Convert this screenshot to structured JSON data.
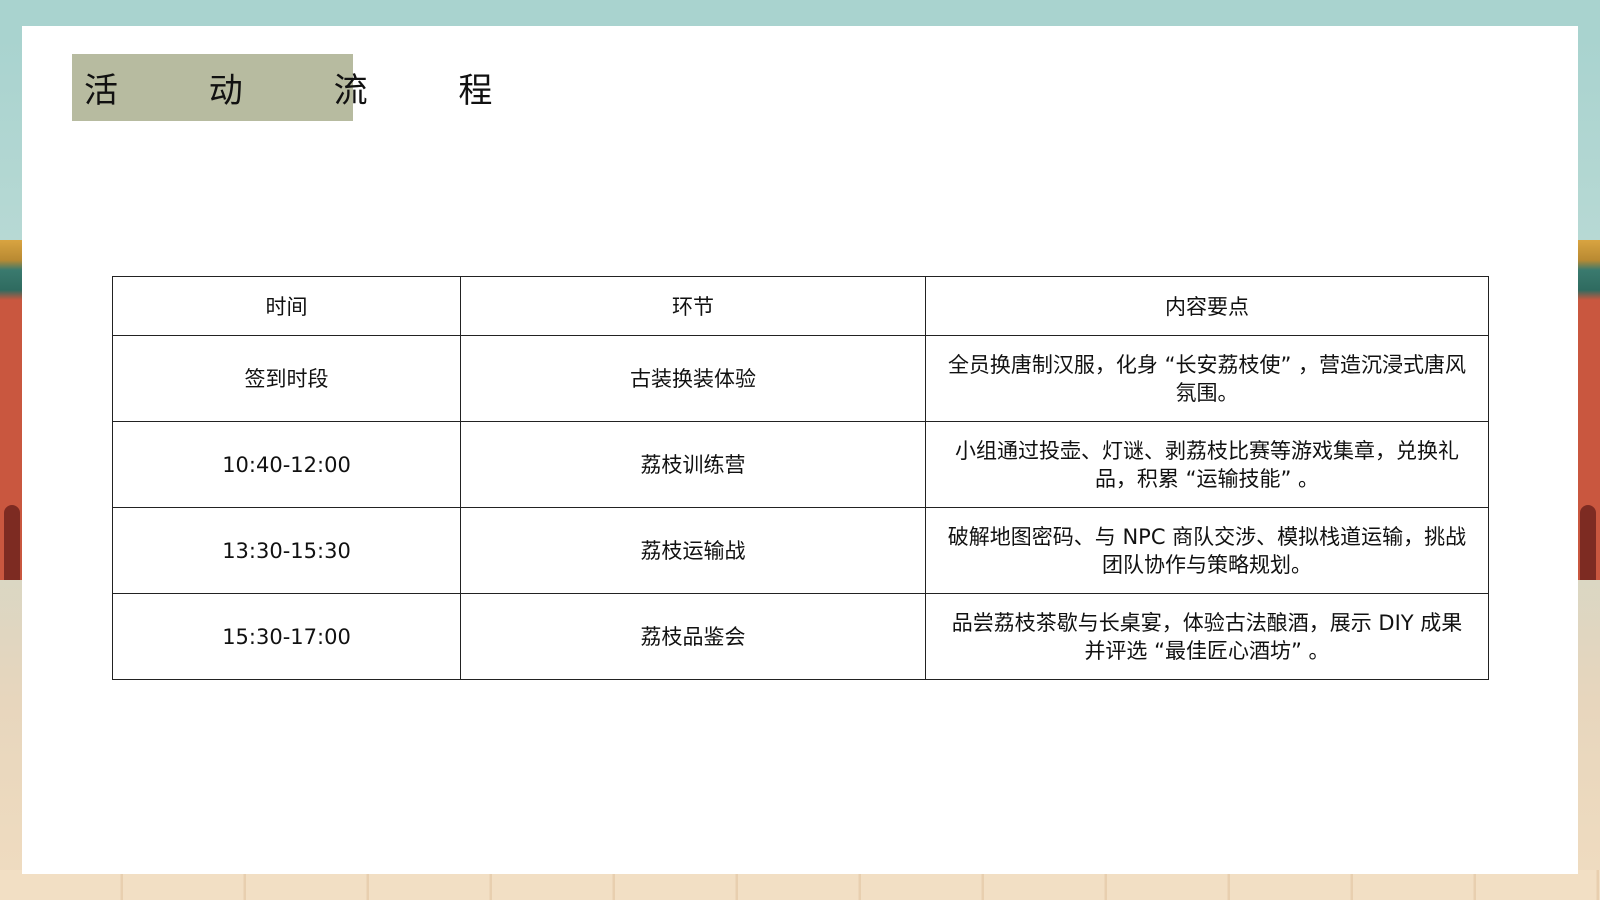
{
  "title": "活 动 流 程",
  "table": {
    "headers": [
      "时间",
      "环节",
      "内容要点"
    ],
    "rows": [
      {
        "time": "签到时段",
        "stage": "古装换装体验",
        "content": "全员换唐制汉服，化身 “长安荔枝使” ，营造沉浸式唐风氛围。"
      },
      {
        "time": "10:40-12:00",
        "stage": "荔枝训练营",
        "content": "小组通过投壶、灯谜、剥荔枝比赛等游戏集章，兑换礼品，积累 “运输技能” 。"
      },
      {
        "time": "13:30-15:30",
        "stage": "荔枝运输战",
        "content": "破解地图密码、与 NPC 商队交涉、模拟栈道运输，挑战团队协作与策略规划。"
      },
      {
        "time": "15:30-17:00",
        "stage": "荔枝品鉴会",
        "content": "品尝荔枝茶歇与长桌宴，体验古法酿酒，展示 DIY 成果并评选 “最佳匠心酒坊” 。"
      }
    ]
  },
  "colors": {
    "title_bg": "#b7bba0",
    "sky": "#a9d3cf",
    "wall": "#c9573f"
  }
}
